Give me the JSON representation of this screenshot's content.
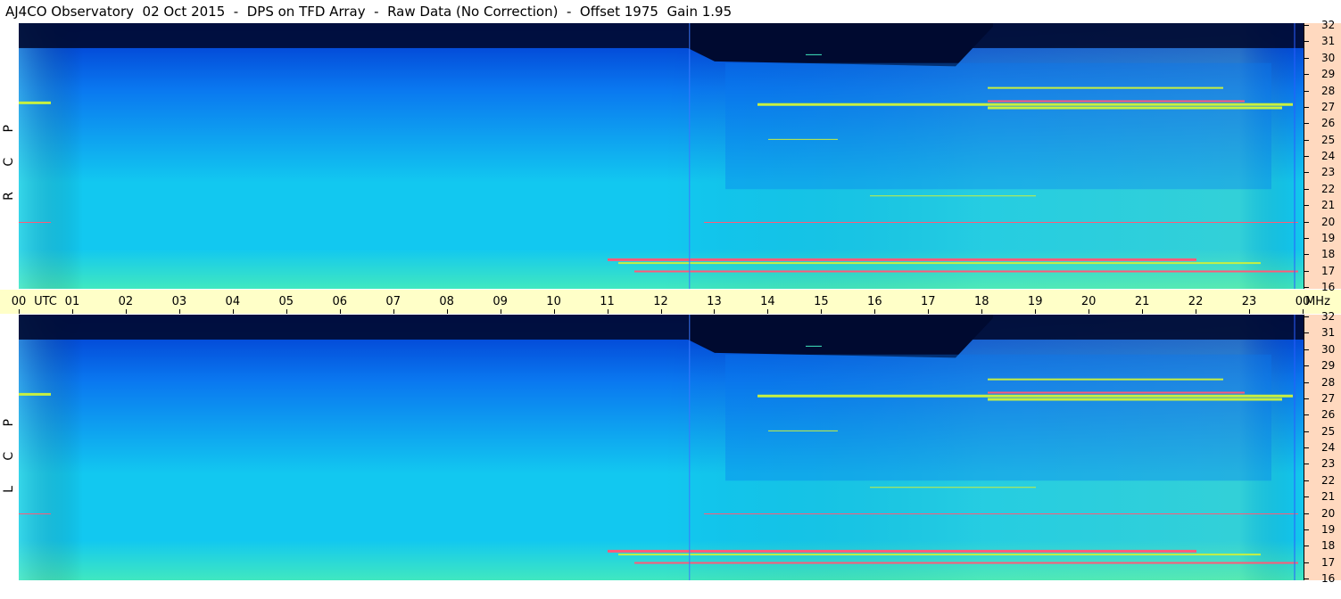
{
  "title": "AJ4CO Observatory  02 Oct 2015  -  DPS on TFD Array  -  Raw Data (No Correction)  -  Offset 1975  Gain 1.95",
  "chart_data": {
    "type": "heatmap",
    "title": "AJ4CO Observatory  02 Oct 2015  -  DPS on TFD Array  -  Raw Data (No Correction)  -  Offset 1975  Gain 1.95",
    "xlabel": "UTC",
    "ylabel": "MHz",
    "x_range": [
      0,
      24
    ],
    "y_range": [
      16,
      32
    ],
    "x_ticks": [
      "00",
      "01",
      "02",
      "03",
      "04",
      "05",
      "06",
      "07",
      "08",
      "09",
      "10",
      "11",
      "12",
      "13",
      "14",
      "15",
      "16",
      "17",
      "18",
      "19",
      "20",
      "21",
      "22",
      "23",
      "00"
    ],
    "x_axis_label": "UTC",
    "y_ticks": [
      16,
      17,
      18,
      19,
      20,
      21,
      22,
      23,
      24,
      25,
      26,
      27,
      28,
      29,
      30,
      31,
      32
    ],
    "y_axis_unit": "MHz",
    "panels": [
      {
        "name": "R C P",
        "polarization": "RCP"
      },
      {
        "name": "L C P",
        "polarization": "LCP"
      }
    ],
    "colormap": [
      "#000a30",
      "#0033cc",
      "#0a78f0",
      "#12c8f0",
      "#40e8c0",
      "#c8f040",
      "#ff5a78"
    ]
  },
  "panels": {
    "top": {
      "label": "R C P"
    },
    "bottom": {
      "label": "L C P"
    }
  }
}
